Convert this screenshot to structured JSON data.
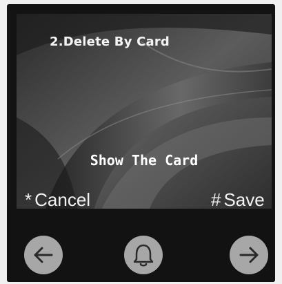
{
  "screen": {
    "title": "2.Delete By Card",
    "prompt": "Show The Card"
  },
  "softkeys": {
    "cancel_mark": "*",
    "cancel_label": "Cancel",
    "save_mark": "#",
    "save_label": "Save"
  },
  "buttons": {
    "left_icon": "arrow-left-icon",
    "center_icon": "bell-icon",
    "right_icon": "arrow-right-icon"
  }
}
